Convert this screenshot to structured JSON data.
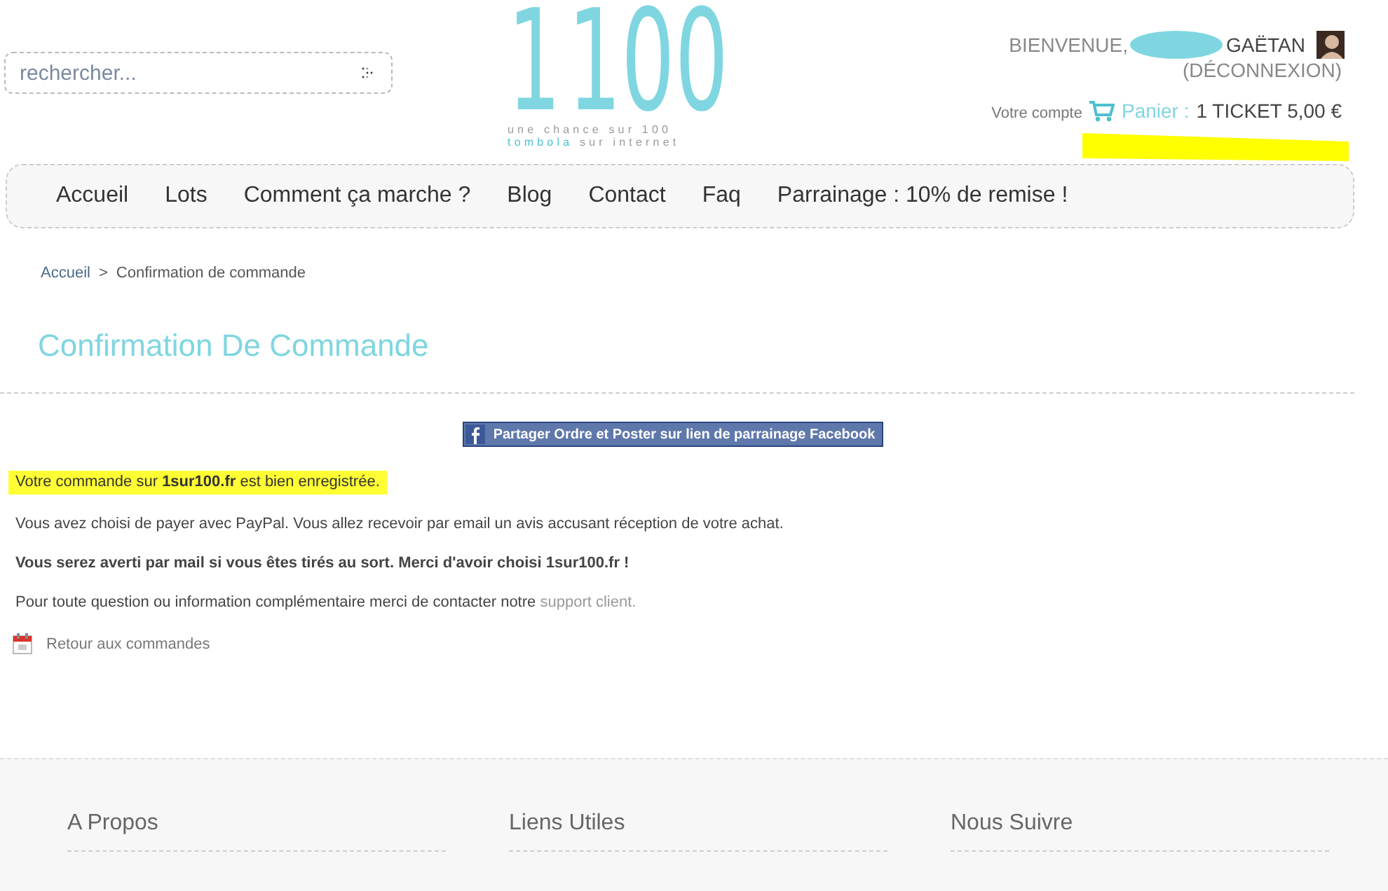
{
  "search": {
    "placeholder": "rechercher..."
  },
  "logo": {
    "first": "1",
    "number": "100",
    "tagline": "une chance sur 100",
    "tagline_highlight": "tombola",
    "tagline_rest": "sur internet"
  },
  "account": {
    "welcome": "BIENVENUE,",
    "name": "GAËTAN",
    "logout": "(DÉCONNEXION)",
    "account_link": "Votre compte",
    "cart_label": "Panier :",
    "cart_value": "1 TICKET 5,00 €"
  },
  "nav": [
    {
      "label": "Accueil"
    },
    {
      "label": "Lots"
    },
    {
      "label": "Comment ça marche ?"
    },
    {
      "label": "Blog"
    },
    {
      "label": "Contact"
    },
    {
      "label": "Faq"
    },
    {
      "label": "Parrainage : 10% de remise !"
    }
  ],
  "breadcrumb": {
    "home": "Accueil",
    "separator": ">",
    "current": "Confirmation de commande"
  },
  "title": "Confirmation De Commande",
  "facebook_button": "Partager Ordre et Poster sur lien de parrainage Facebook",
  "messages": [
    {
      "kind": "highlight",
      "text": "Votre commande sur **1sur100.fr** est bien enregistrée."
    },
    {
      "kind": "plain",
      "text": "Vous avez choisi de payer avec PayPal. Vous allez recevoir par email un avis accusant réception de votre achat."
    },
    {
      "kind": "bold",
      "text": "Vous serez averti par mail si vous êtes tirés au sort. Merci d'avoir choisi 1sur100.fr !"
    },
    {
      "kind": "link",
      "text": "Pour toute question ou information complémentaire merci de contacter notre",
      "link": "support client."
    }
  ],
  "back_link": "Retour aux commandes",
  "footer": [
    {
      "heading": "A Propos"
    },
    {
      "heading": "Liens Utiles"
    },
    {
      "heading": "Nous Suivre"
    }
  ]
}
